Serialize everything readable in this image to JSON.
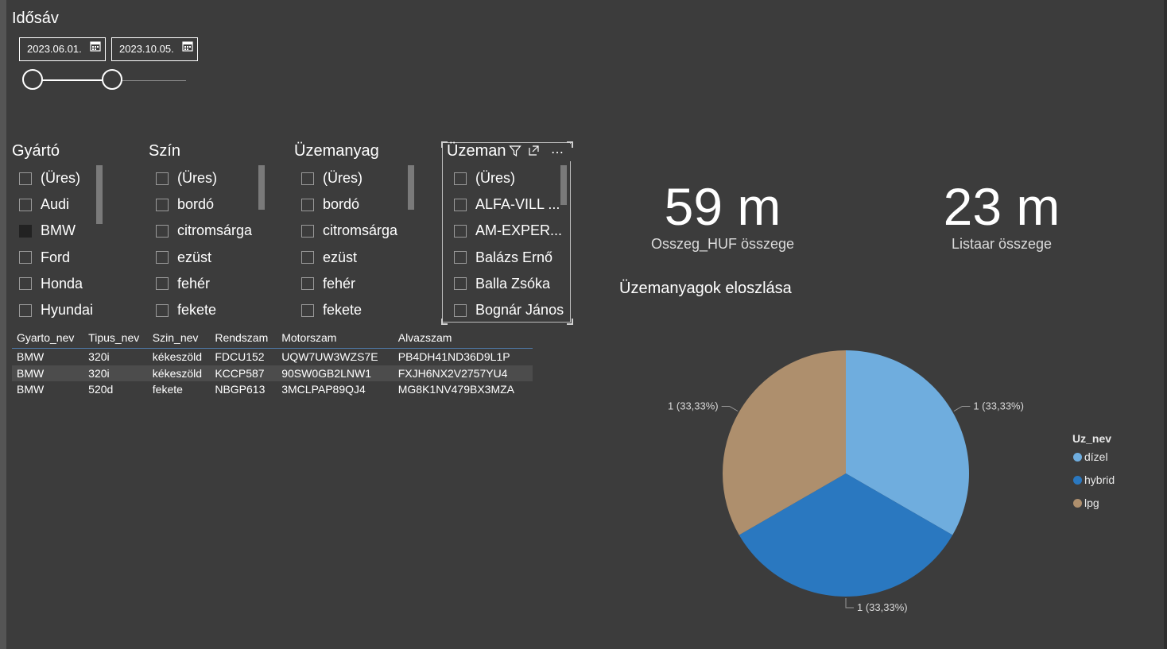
{
  "date_slicer": {
    "title": "Idősáv",
    "start": "2023.06.01.",
    "end": "2023.10.05.",
    "range_start_fraction": 0.0,
    "range_end_fraction": 0.52
  },
  "slicers": [
    {
      "title": "Gyártó",
      "items": [
        "(Üres)",
        "Audi",
        "BMW",
        "Ford",
        "Honda",
        "Hyundai"
      ],
      "checked": [
        2
      ]
    },
    {
      "title": "Szín",
      "items": [
        "(Üres)",
        "bordó",
        "citromsárga",
        "ezüst",
        "fehér",
        "fekete"
      ],
      "checked": []
    },
    {
      "title": "Üzemanyag",
      "items": [
        "(Üres)",
        "bordó",
        "citromsárga",
        "ezüst",
        "fehér",
        "fekete"
      ],
      "checked": []
    },
    {
      "title": "Üzeman",
      "items": [
        "(Üres)",
        "ALFA-VILL ...",
        "AM-EXPER...",
        "Balázs Ernő",
        "Balla Zsóka",
        "Bognár János"
      ],
      "checked": []
    }
  ],
  "table": {
    "columns": [
      "Gyarto_nev",
      "Tipus_nev",
      "Szin_nev",
      "Rendszam",
      "Motorszam",
      "Alvazszam"
    ],
    "rows": [
      [
        "BMW",
        "320i",
        "kékeszöld",
        "FDCU152",
        "UQW7UW3WZS7E",
        "PB4DH41ND36D9L1P"
      ],
      [
        "BMW",
        "320i",
        "kékeszöld",
        "KCCP587",
        "90SW0GB2LNW1",
        "FXJH6NX2V2757YU4"
      ],
      [
        "BMW",
        "520d",
        "fekete",
        "NBGP613",
        "3MCLPAP89QJ4",
        "MG8K1NV479BX3MZA"
      ]
    ]
  },
  "kpis": [
    {
      "value": "59 m",
      "label": "Osszeg_HUF összege"
    },
    {
      "value": "23 m",
      "label": "Listaar összege"
    }
  ],
  "chart_title": "Üzemanyagok eloszlása",
  "legend_title": "Uz_nev",
  "colors": {
    "dizel": "#6fadde",
    "hybrid": "#2a78c0",
    "lpg": "#ae8f6d",
    "accent": "#4f79a7"
  },
  "icons": {
    "date": "calendar-icon",
    "filter": "filter-icon",
    "focus": "focus-mode-icon",
    "more": "more-options-icon"
  },
  "chart_data": {
    "type": "pie",
    "title": "Üzemanyagok eloszlása",
    "legend_title": "Uz_nev",
    "legend_position": "right",
    "slices": [
      {
        "label": "dízel",
        "value": 1,
        "percent": 33.33,
        "data_label": "1 (33,33%)",
        "color": "#6fadde"
      },
      {
        "label": "hybrid",
        "value": 1,
        "percent": 33.33,
        "data_label": "1 (33,33%)",
        "color": "#2a78c0"
      },
      {
        "label": "lpg",
        "value": 1,
        "percent": 33.33,
        "data_label": "1 (33,33%)",
        "color": "#ae8f6d"
      }
    ]
  }
}
